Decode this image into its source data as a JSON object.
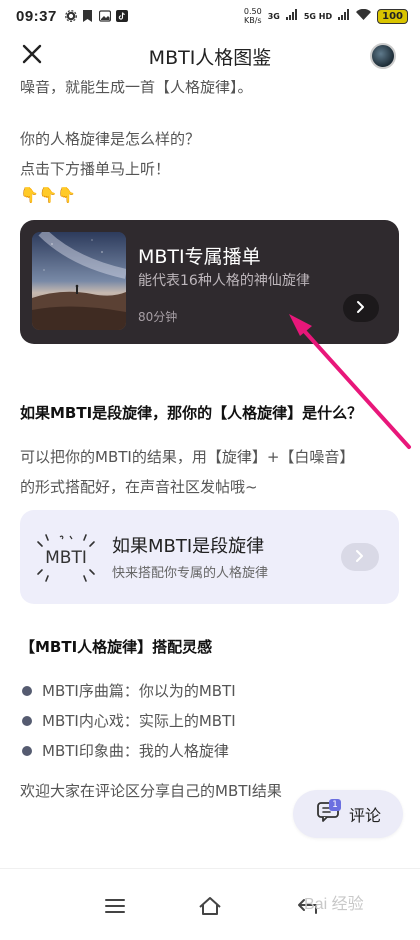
{
  "status_bar": {
    "time": "09:37",
    "net_speed_value": "0.50",
    "net_speed_unit": "KB/s",
    "signal_1": "3G",
    "signal_2": "5G HD",
    "battery": "100"
  },
  "header": {
    "title": "MBTI人格图鉴"
  },
  "article": {
    "cut_line": "噪音，就能生成一首【人格旋律】。",
    "question": "你的人格旋律是怎么样的？",
    "call_to_action": "点击下方播单马上听！",
    "emojis": "👇👇👇",
    "playlist": {
      "title": "MBTI专属播单",
      "subtitle": "能代表16种人格的神仙旋律",
      "duration": "80分钟"
    },
    "heading_1": "如果MBTI是段旋律，那你的【人格旋律】是什么？",
    "para_1_line_1": "可以把你的MBTI的结果，用【旋律】+【白噪音】",
    "para_1_line_2": "的形式搭配好，在声音社区发帖哦~",
    "mbti_card": {
      "logo_text": "MBTI",
      "title": "如果MBTI是段旋律",
      "subtitle": "快来搭配你专属的人格旋律"
    },
    "heading_2": "【MBTI人格旋律】搭配灵感",
    "bullets": [
      "MBTI序曲篇：你以为的MBTI",
      "MBTI内心戏：实际上的MBTI",
      "MBTI印象曲：我的人格旋律"
    ],
    "closing": "欢迎大家在评论区分享自己的MBTI结果"
  },
  "comment_fab": {
    "label": "评论",
    "badge": "1"
  },
  "watermark": "Bai 经验",
  "colors": {
    "playlist_bg": "#2f2a2e",
    "card_bg": "#eeeefa",
    "annotation_arrow": "#e8177a",
    "battery": "#d9c400"
  }
}
